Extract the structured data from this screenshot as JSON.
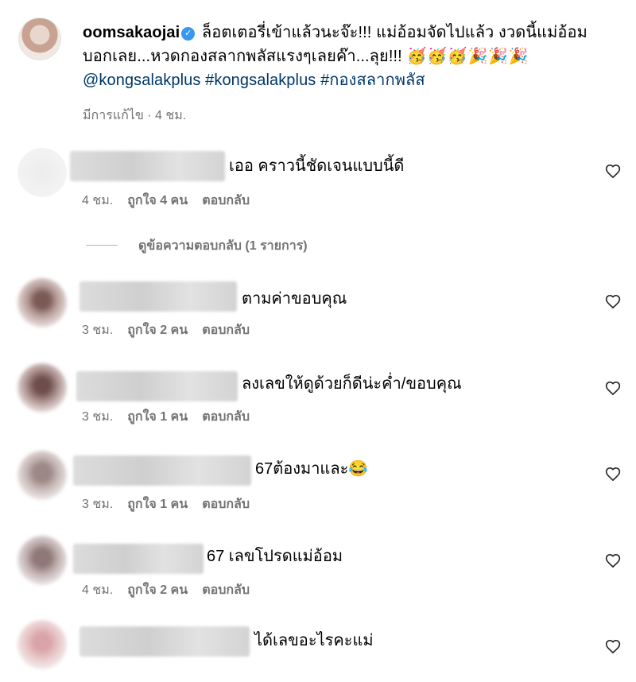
{
  "post": {
    "username": "oomsakaojai",
    "caption_part1": " ล็อตเตอรี่เข้าแล้วนะจ๊ะ!!! แม่อ้อมจัดไปแล้ว งวดนี้แม่อ้อมบอกเลย...หวดกองสลากพลัสแรงๆเลยค๊า...ลุย!!! ",
    "emojis": [
      "🥳",
      "🥳",
      "🥳",
      "🎉",
      "🎉",
      "🎉"
    ],
    "mention": "@kongsalakplus",
    "hashtag1": "#kongsalakplus",
    "hashtag2": "#กองสลากพลัส",
    "edited_label": "มีการแก้ไข · 4 ชม."
  },
  "view_replies": "ดูข้อความตอบกลับ (1 รายการ)",
  "comments": [
    {
      "text": "เออ คราวนี้ชัดเจนแบบนี้ดี",
      "time": "4 ชม.",
      "likes": "ถูกใจ 4 คน",
      "reply": "ตอบกลับ"
    },
    {
      "text": "ตามค่าขอบคุณ",
      "time": "3 ชม.",
      "likes": "ถูกใจ 2 คน",
      "reply": "ตอบกลับ"
    },
    {
      "text": "ลงเลขให้ดูด้วยก็ดีน่ะค่ำ/ขอบคุณ",
      "time": "3 ชม.",
      "likes": "ถูกใจ 1 คน",
      "reply": "ตอบกลับ"
    },
    {
      "text": "67ต้องมาและ😂",
      "time": "3 ชม.",
      "likes": "ถูกใจ 1 คน",
      "reply": "ตอบกลับ"
    },
    {
      "text": "67 เลขโปรดแม่อ้อม",
      "time": "4 ชม.",
      "likes": "ถูกใจ 2 คน",
      "reply": "ตอบกลับ"
    },
    {
      "text": "ได้เลขอะไรคะแม่",
      "time": "",
      "likes": "",
      "reply": ""
    }
  ],
  "colors": {
    "link": "#00376b",
    "meta": "#737373",
    "verified": "#3897f0"
  }
}
